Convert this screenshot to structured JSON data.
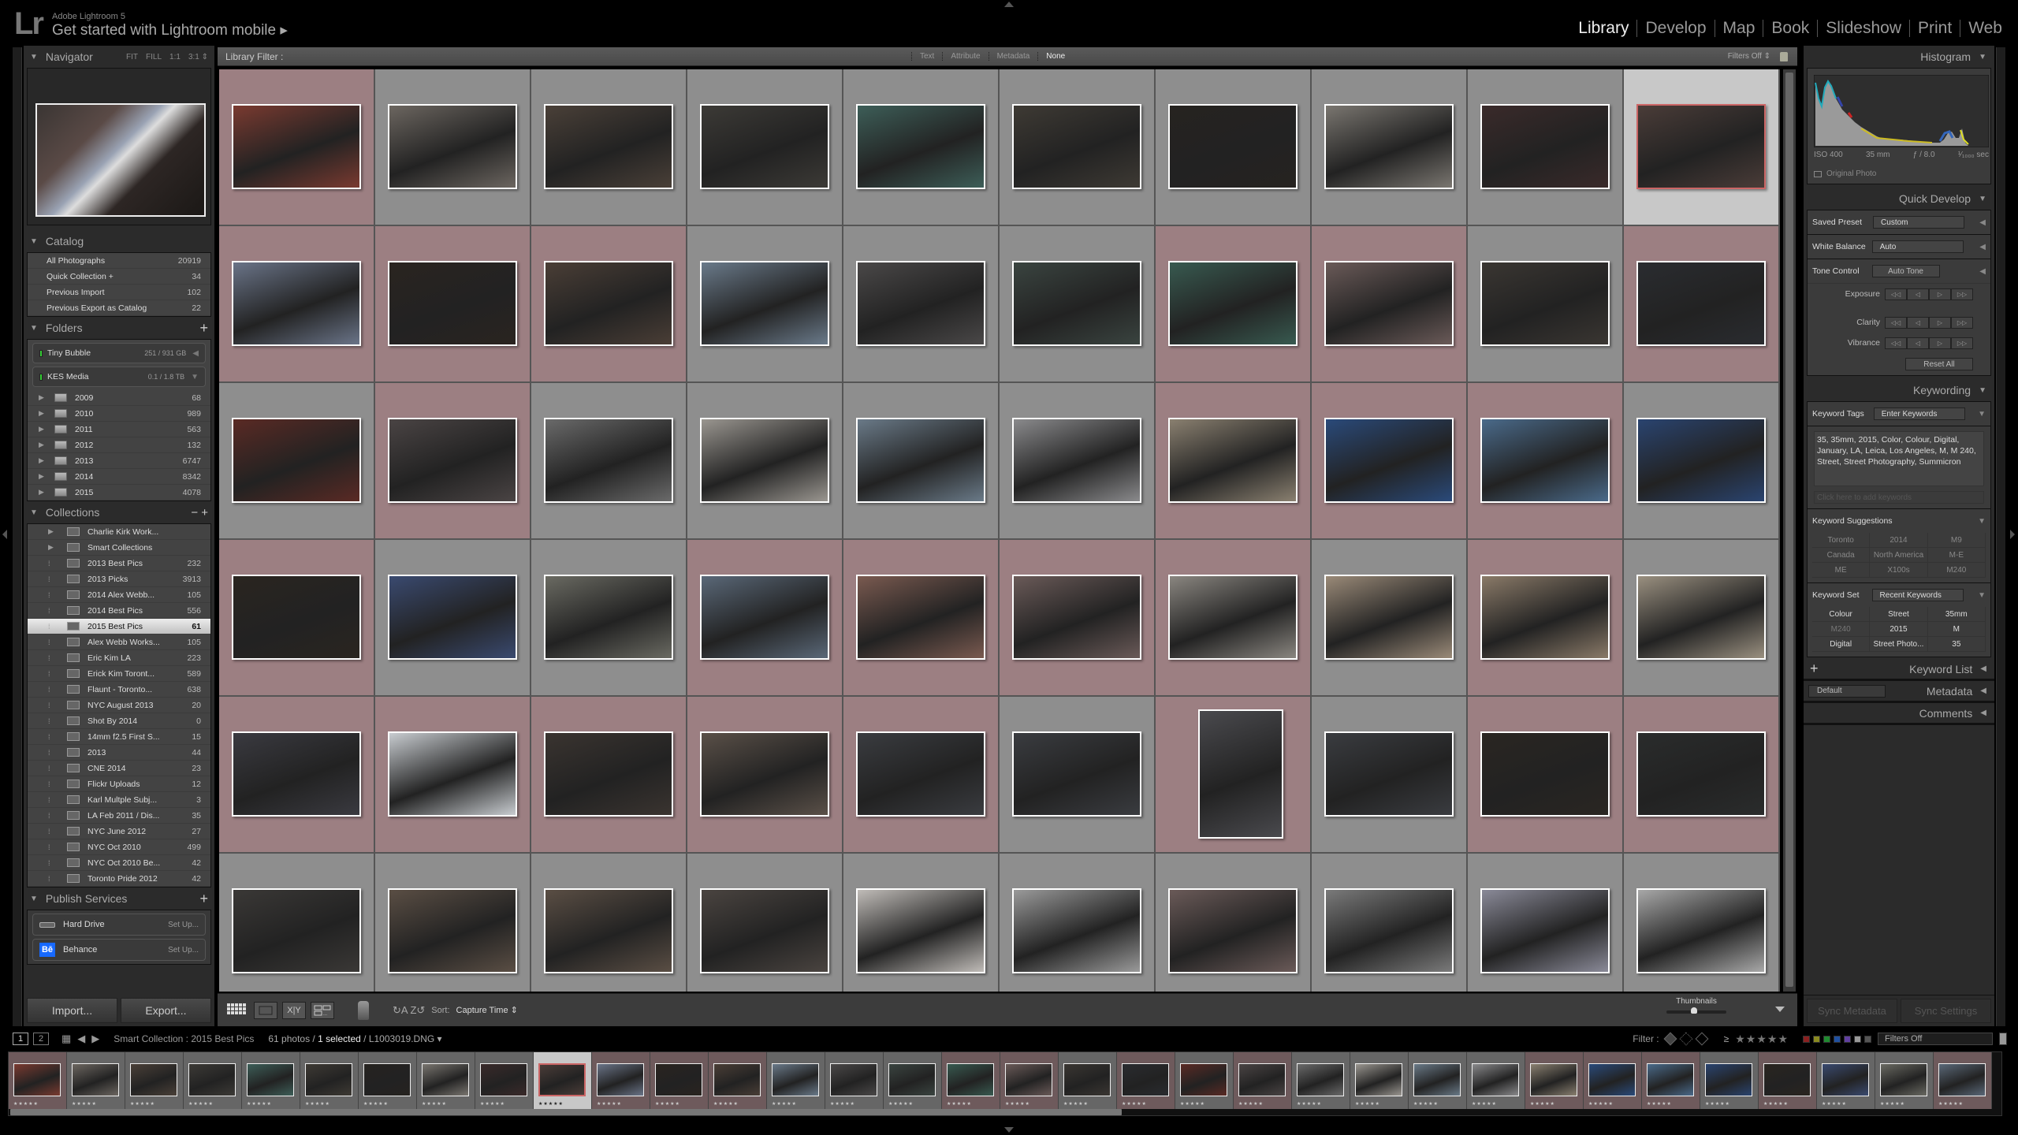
{
  "app": {
    "logo": "Lr",
    "name": "Adobe Lightroom 5",
    "mobile_prompt": "Get started with Lightroom mobile ▸"
  },
  "modules": [
    {
      "label": "Library",
      "active": true
    },
    {
      "label": "Develop",
      "active": false
    },
    {
      "label": "Map",
      "active": false
    },
    {
      "label": "Book",
      "active": false
    },
    {
      "label": "Slideshow",
      "active": false
    },
    {
      "label": "Print",
      "active": false
    },
    {
      "label": "Web",
      "active": false
    }
  ],
  "navigator": {
    "title": "Navigator",
    "zoom_options": [
      "FIT",
      "FILL",
      "1:1",
      "3:1 ⇕"
    ]
  },
  "catalog": {
    "title": "Catalog",
    "items": [
      {
        "label": "All Photographs",
        "count": "20919"
      },
      {
        "label": "Quick Collection +",
        "count": "34"
      },
      {
        "label": "Previous Import",
        "count": "102"
      },
      {
        "label": "Previous Export as Catalog",
        "count": "22"
      }
    ]
  },
  "folders": {
    "title": "Folders",
    "add": "+",
    "volumes": [
      {
        "name": "Tiny Bubble",
        "size": "251 / 931 GB",
        "arrow": "◀"
      },
      {
        "name": "KES Media",
        "size": "0.1 / 1.8 TB",
        "arrow": "▼"
      }
    ],
    "items": [
      {
        "label": "2009",
        "count": "68"
      },
      {
        "label": "2010",
        "count": "989"
      },
      {
        "label": "2011",
        "count": "563"
      },
      {
        "label": "2012",
        "count": "132"
      },
      {
        "label": "2013",
        "count": "6747"
      },
      {
        "label": "2014",
        "count": "8342"
      },
      {
        "label": "2015",
        "count": "4078"
      }
    ]
  },
  "collections": {
    "title": "Collections",
    "controls": "−  +",
    "items": [
      {
        "label": "Charlie Kirk Work...",
        "count": "",
        "set": true
      },
      {
        "label": "Smart Collections",
        "count": "",
        "set": true
      },
      {
        "label": "2013 Best Pics",
        "count": "232"
      },
      {
        "label": "2013 Picks",
        "count": "3913"
      },
      {
        "label": "2014 Alex Webb...",
        "count": "105"
      },
      {
        "label": "2014 Best Pics",
        "count": "556"
      },
      {
        "label": "2015 Best Pics",
        "count": "61",
        "selected": true
      },
      {
        "label": "Alex Webb Works...",
        "count": "105"
      },
      {
        "label": "Eric Kim LA",
        "count": "223"
      },
      {
        "label": "Erick Kim Toront...",
        "count": "589"
      },
      {
        "label": "Flaunt - Toronto...",
        "count": "638"
      },
      {
        "label": "NYC August 2013",
        "count": "20"
      },
      {
        "label": "Shot By 2014",
        "count": "0"
      },
      {
        "label": "14mm f2.5 First S...",
        "count": "15"
      },
      {
        "label": "2013",
        "count": "44"
      },
      {
        "label": "CNE 2014",
        "count": "23"
      },
      {
        "label": "Flickr Uploads",
        "count": "12"
      },
      {
        "label": "Karl Multple Subj...",
        "count": "3"
      },
      {
        "label": "LA Feb 2011 / Dis...",
        "count": "35"
      },
      {
        "label": "NYC June 2012",
        "count": "27"
      },
      {
        "label": "NYC Oct 2010",
        "count": "499"
      },
      {
        "label": "NYC Oct 2010 Be...",
        "count": "42"
      },
      {
        "label": "Toronto Pride 2012",
        "count": "42"
      }
    ]
  },
  "publish": {
    "title": "Publish Services",
    "add": "+",
    "services": [
      {
        "name": "Hard Drive",
        "action": "Set Up..."
      },
      {
        "name": "Behance",
        "action": "Set Up..."
      }
    ]
  },
  "buttons": {
    "import": "Import...",
    "export": "Export..."
  },
  "library_filter": {
    "title": "Library Filter :",
    "tabs": [
      {
        "label": "Text",
        "active": false
      },
      {
        "label": "Attribute",
        "active": false
      },
      {
        "label": "Metadata",
        "active": false
      },
      {
        "label": "None",
        "active": true
      }
    ],
    "preset": "Filters Off ⇕"
  },
  "grid": {
    "columns": 10,
    "label_color": "#9c7f82",
    "cells": [
      {
        "l": "red",
        "c": "#7a3a30"
      },
      {
        "l": "none",
        "c": "#6c6660"
      },
      {
        "l": "none",
        "c": "#4a4038"
      },
      {
        "l": "none",
        "c": "#3c3a36"
      },
      {
        "l": "none",
        "c": "#3d5e58"
      },
      {
        "l": "none",
        "c": "#3e3a34"
      },
      {
        "l": "none",
        "c": "#262320"
      },
      {
        "l": "none",
        "c": "#7a7670"
      },
      {
        "l": "none",
        "c": "#3a2a2a"
      },
      {
        "l": "none",
        "c": "#4a3c38",
        "selected": true
      },
      {
        "l": "red",
        "c": "#6a7488"
      },
      {
        "l": "red",
        "c": "#2a2420"
      },
      {
        "l": "red",
        "c": "#4a3e36"
      },
      {
        "l": "none",
        "c": "#6a7a8a"
      },
      {
        "l": "none",
        "c": "#4a4848"
      },
      {
        "l": "none",
        "c": "#3a4440"
      },
      {
        "l": "red",
        "c": "#385a50"
      },
      {
        "l": "red",
        "c": "#6a5a58"
      },
      {
        "l": "none",
        "c": "#3a3632"
      },
      {
        "l": "red",
        "c": "#2a2c30"
      },
      {
        "l": "none",
        "c": "#5a2a24"
      },
      {
        "l": "red",
        "c": "#4a4444"
      },
      {
        "l": "none",
        "c": "#6a6a6a"
      },
      {
        "l": "none",
        "c": "#9a9690"
      },
      {
        "l": "none",
        "c": "#6a7a88"
      },
      {
        "l": "none",
        "c": "#8a8a8c"
      },
      {
        "l": "red",
        "c": "#8a8070"
      },
      {
        "l": "red",
        "c": "#2a4a7a"
      },
      {
        "l": "red",
        "c": "#4a6a8a"
      },
      {
        "l": "none",
        "c": "#2a4470"
      },
      {
        "l": "red",
        "c": "#2a2520"
      },
      {
        "l": "none",
        "c": "#3a4a70"
      },
      {
        "l": "none",
        "c": "#6a6a62"
      },
      {
        "l": "red",
        "c": "#5a6878"
      },
      {
        "l": "red",
        "c": "#7a5a50"
      },
      {
        "l": "red",
        "c": "#6a5a58"
      },
      {
        "l": "red",
        "c": "#8a8680"
      },
      {
        "l": "none",
        "c": "#9a8a78"
      },
      {
        "l": "red",
        "c": "#8a7a68"
      },
      {
        "l": "none",
        "c": "#9a9080"
      },
      {
        "l": "red",
        "c": "#3a3a40"
      },
      {
        "l": "red",
        "c": "#c8ccd0"
      },
      {
        "l": "red",
        "c": "#3a3430"
      },
      {
        "l": "red",
        "c": "#5a5048"
      },
      {
        "l": "red",
        "c": "#3a3c40"
      },
      {
        "l": "none",
        "c": "#3a3c40"
      },
      {
        "l": "red",
        "c": "#4a4a4e",
        "portrait": true
      },
      {
        "l": "none",
        "c": "#3a3c40"
      },
      {
        "l": "red",
        "c": "#2a2622"
      },
      {
        "l": "red",
        "c": "#2a2c2c"
      },
      {
        "l": "none",
        "c": "#3a3836"
      },
      {
        "l": "none",
        "c": "#5a4e44"
      },
      {
        "l": "none",
        "c": "#5a4e44"
      },
      {
        "l": "none",
        "c": "#4a4440"
      },
      {
        "l": "none",
        "c": "#c0bcb8"
      },
      {
        "l": "none",
        "c": "#9a9a9a"
      },
      {
        "l": "none",
        "c": "#6a5a58"
      },
      {
        "l": "none",
        "c": "#7a7a7a"
      },
      {
        "l": "none",
        "c": "#8a8a98"
      },
      {
        "l": "none",
        "c": "#a8a8a8"
      }
    ]
  },
  "toolbar": {
    "view_icons": [
      "grid-view",
      "loupe-view",
      "compare-view",
      "survey-view"
    ],
    "compare_label": "X|Y",
    "sort_label": "Sort:",
    "sort_value": "Capture Time ⇕",
    "thumbnails_label": "Thumbnails",
    "thumbnail_size": 0.45
  },
  "histogram": {
    "title": "Histogram",
    "iso": "ISO 400",
    "focal": "35 mm",
    "aperture": "ƒ / 8.0",
    "shutter": "¹⁄₁₀₀₀ sec",
    "original_photo": "Original Photo"
  },
  "quick_develop": {
    "title": "Quick Develop",
    "saved_preset_label": "Saved Preset",
    "saved_preset_value": "Custom",
    "white_balance_label": "White Balance",
    "white_balance_value": "Auto",
    "tone_control_label": "Tone Control",
    "auto_tone": "Auto Tone",
    "steppers": [
      "Exposure",
      "Clarity",
      "Vibrance"
    ],
    "step_glyphs": [
      "◁◁",
      "◁",
      "▷",
      "▷▷"
    ],
    "reset_all": "Reset All"
  },
  "keywording": {
    "title": "Keywording",
    "tags_label": "Keyword Tags",
    "tags_mode": "Enter Keywords",
    "tags_text": "35, 35mm, 2015, Color, Colour, Digital, January, LA, Leica, Los Angeles, M, M 240, Street, Street Photography, Summicron",
    "add_placeholder": "Click here to add keywords",
    "suggestions_label": "Keyword Suggestions",
    "suggestions": [
      "Toronto",
      "2014",
      "M9",
      "Canada",
      "North America",
      "M-E",
      "ME",
      "X100s",
      "M240"
    ],
    "set_label": "Keyword Set",
    "set_value": "Recent Keywords",
    "set_keywords": [
      "Colour",
      "Street",
      "35mm",
      "M240",
      "2015",
      "M",
      "Digital",
      "Street Photo...",
      "35"
    ]
  },
  "right_sections": {
    "keyword_list": "Keyword List",
    "metadata": "Metadata",
    "metadata_preset": "Default",
    "comments": "Comments"
  },
  "sync": {
    "metadata": "Sync Metadata",
    "settings": "Sync Settings"
  },
  "status_bar": {
    "screen1": "1",
    "screen2": "2",
    "source": "Smart Collection : 2015 Best Pics",
    "photos": "61 photos /",
    "selected": "1 selected",
    "filename": "/ L1003019.DNG ▾",
    "filter_label": "Filter :",
    "rating_op": "≥",
    "stars": "★★★★★",
    "label_colors": [
      "#8a2020",
      "#8a8a20",
      "#208a30",
      "#2050a0",
      "#6040a0",
      "#999999",
      "#555555"
    ],
    "filter_preset": "Filters Off"
  },
  "filmstrip": {
    "stars": "★★★★★",
    "cells": [
      {
        "l": "red",
        "c": "#7a3a30"
      },
      {
        "l": "none",
        "c": "#6c6660"
      },
      {
        "l": "none",
        "c": "#4a4038"
      },
      {
        "l": "none",
        "c": "#3c3a36"
      },
      {
        "l": "none",
        "c": "#3d5e58"
      },
      {
        "l": "none",
        "c": "#3e3a34"
      },
      {
        "l": "none",
        "c": "#262320"
      },
      {
        "l": "none",
        "c": "#7a7670"
      },
      {
        "l": "none",
        "c": "#3a2a2a"
      },
      {
        "l": "none",
        "c": "#4a3c38",
        "selected": true
      },
      {
        "l": "red",
        "c": "#6a7488"
      },
      {
        "l": "red",
        "c": "#2a2420"
      },
      {
        "l": "red",
        "c": "#4a3e36"
      },
      {
        "l": "none",
        "c": "#6a7a8a"
      },
      {
        "l": "none",
        "c": "#4a4848"
      },
      {
        "l": "none",
        "c": "#3a4440"
      },
      {
        "l": "red",
        "c": "#385a50"
      },
      {
        "l": "red",
        "c": "#6a5a58"
      },
      {
        "l": "none",
        "c": "#3a3632"
      },
      {
        "l": "red",
        "c": "#2a2c30"
      },
      {
        "l": "none",
        "c": "#5a2a24"
      },
      {
        "l": "red",
        "c": "#4a4444"
      },
      {
        "l": "none",
        "c": "#6a6a6a"
      },
      {
        "l": "none",
        "c": "#9a9690"
      },
      {
        "l": "none",
        "c": "#6a7a88"
      },
      {
        "l": "none",
        "c": "#8a8a8c"
      },
      {
        "l": "red",
        "c": "#8a8070"
      },
      {
        "l": "red",
        "c": "#2a4a7a"
      },
      {
        "l": "red",
        "c": "#4a6a8a"
      },
      {
        "l": "none",
        "c": "#2a4470"
      },
      {
        "l": "red",
        "c": "#2a2520"
      },
      {
        "l": "none",
        "c": "#3a4a70"
      },
      {
        "l": "none",
        "c": "#6a6a62"
      },
      {
        "l": "red",
        "c": "#5a6878"
      }
    ]
  }
}
